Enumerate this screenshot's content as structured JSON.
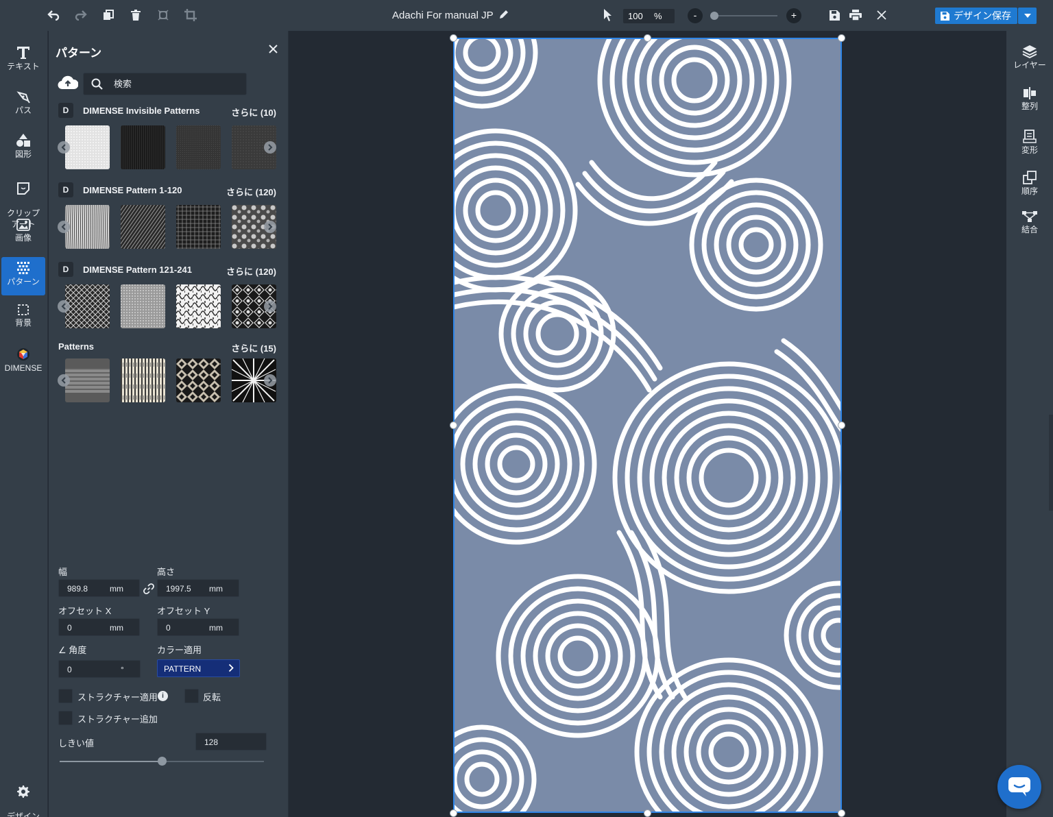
{
  "toolbar": {
    "doc_title": "Adachi For manual JP",
    "zoom_value": "100",
    "zoom_unit": "%",
    "zoom_minus": "-",
    "zoom_plus": "+",
    "zoom_slider_level": 0.06,
    "save_label": "デザイン保存"
  },
  "left_tools": [
    {
      "label": "テキスト",
      "icon": "text-icon"
    },
    {
      "label": "パス",
      "icon": "pen-icon"
    },
    {
      "label": "図形",
      "icon": "shapes-icon"
    },
    {
      "label": "クリップ\nアート",
      "icon": "clipart-icon"
    },
    {
      "label": "画像",
      "icon": "image-icon"
    },
    {
      "label": "パターン",
      "icon": "pattern-icon"
    },
    {
      "label": "背景",
      "icon": "background-icon"
    },
    {
      "label": "DIMENSE",
      "icon": "dimense-logo-icon"
    },
    {
      "label": "デザイン\n設定",
      "icon": "gear-icon"
    }
  ],
  "panel": {
    "title": "パターン",
    "search_placeholder": "検索",
    "sections": [
      {
        "badge": "D",
        "name": "DIMENSE Invisible Patterns",
        "more": "さらに (10)"
      },
      {
        "badge": "D",
        "name": "DIMENSE Pattern 1-120",
        "more": "さらに (120)"
      },
      {
        "badge": "D",
        "name": "DIMENSE Pattern 121-241",
        "more": "さらに (120)"
      },
      {
        "badge": "",
        "name": "Patterns",
        "more": "さらに (15)"
      }
    ],
    "width_label": "幅",
    "width_value": "989.8",
    "height_label": "高さ",
    "height_value": "1997.5",
    "unit_mm": "mm",
    "offset_x_label": "オフセット X",
    "offset_x_value": "0",
    "offset_y_label": "オフセット Y",
    "offset_y_value": "0",
    "angle_label": "∠ 角度",
    "angle_value": "0",
    "angle_unit": "°",
    "color_label": "カラー適用",
    "color_value": "PATTERN",
    "texture_apply_label": "ストラクチャー適用",
    "info_glyph": "i",
    "invert_label": "反転",
    "texture_add_label": "ストラクチャー追加",
    "threshold_label": "しきい値",
    "threshold_value": "128",
    "threshold_level": 0.5
  },
  "right_tools": [
    {
      "label": "レイヤー",
      "icon": "layers-icon"
    },
    {
      "label": "整列",
      "icon": "align-icon"
    },
    {
      "label": "変形",
      "icon": "transform-icon"
    },
    {
      "label": "順序",
      "icon": "order-icon"
    },
    {
      "label": "結合",
      "icon": "combine-icon"
    }
  ],
  "colors": {
    "accent": "#1f6fcc",
    "pattern_stroke": "#7a8ba8",
    "pattern_fill": "#ffffff"
  }
}
